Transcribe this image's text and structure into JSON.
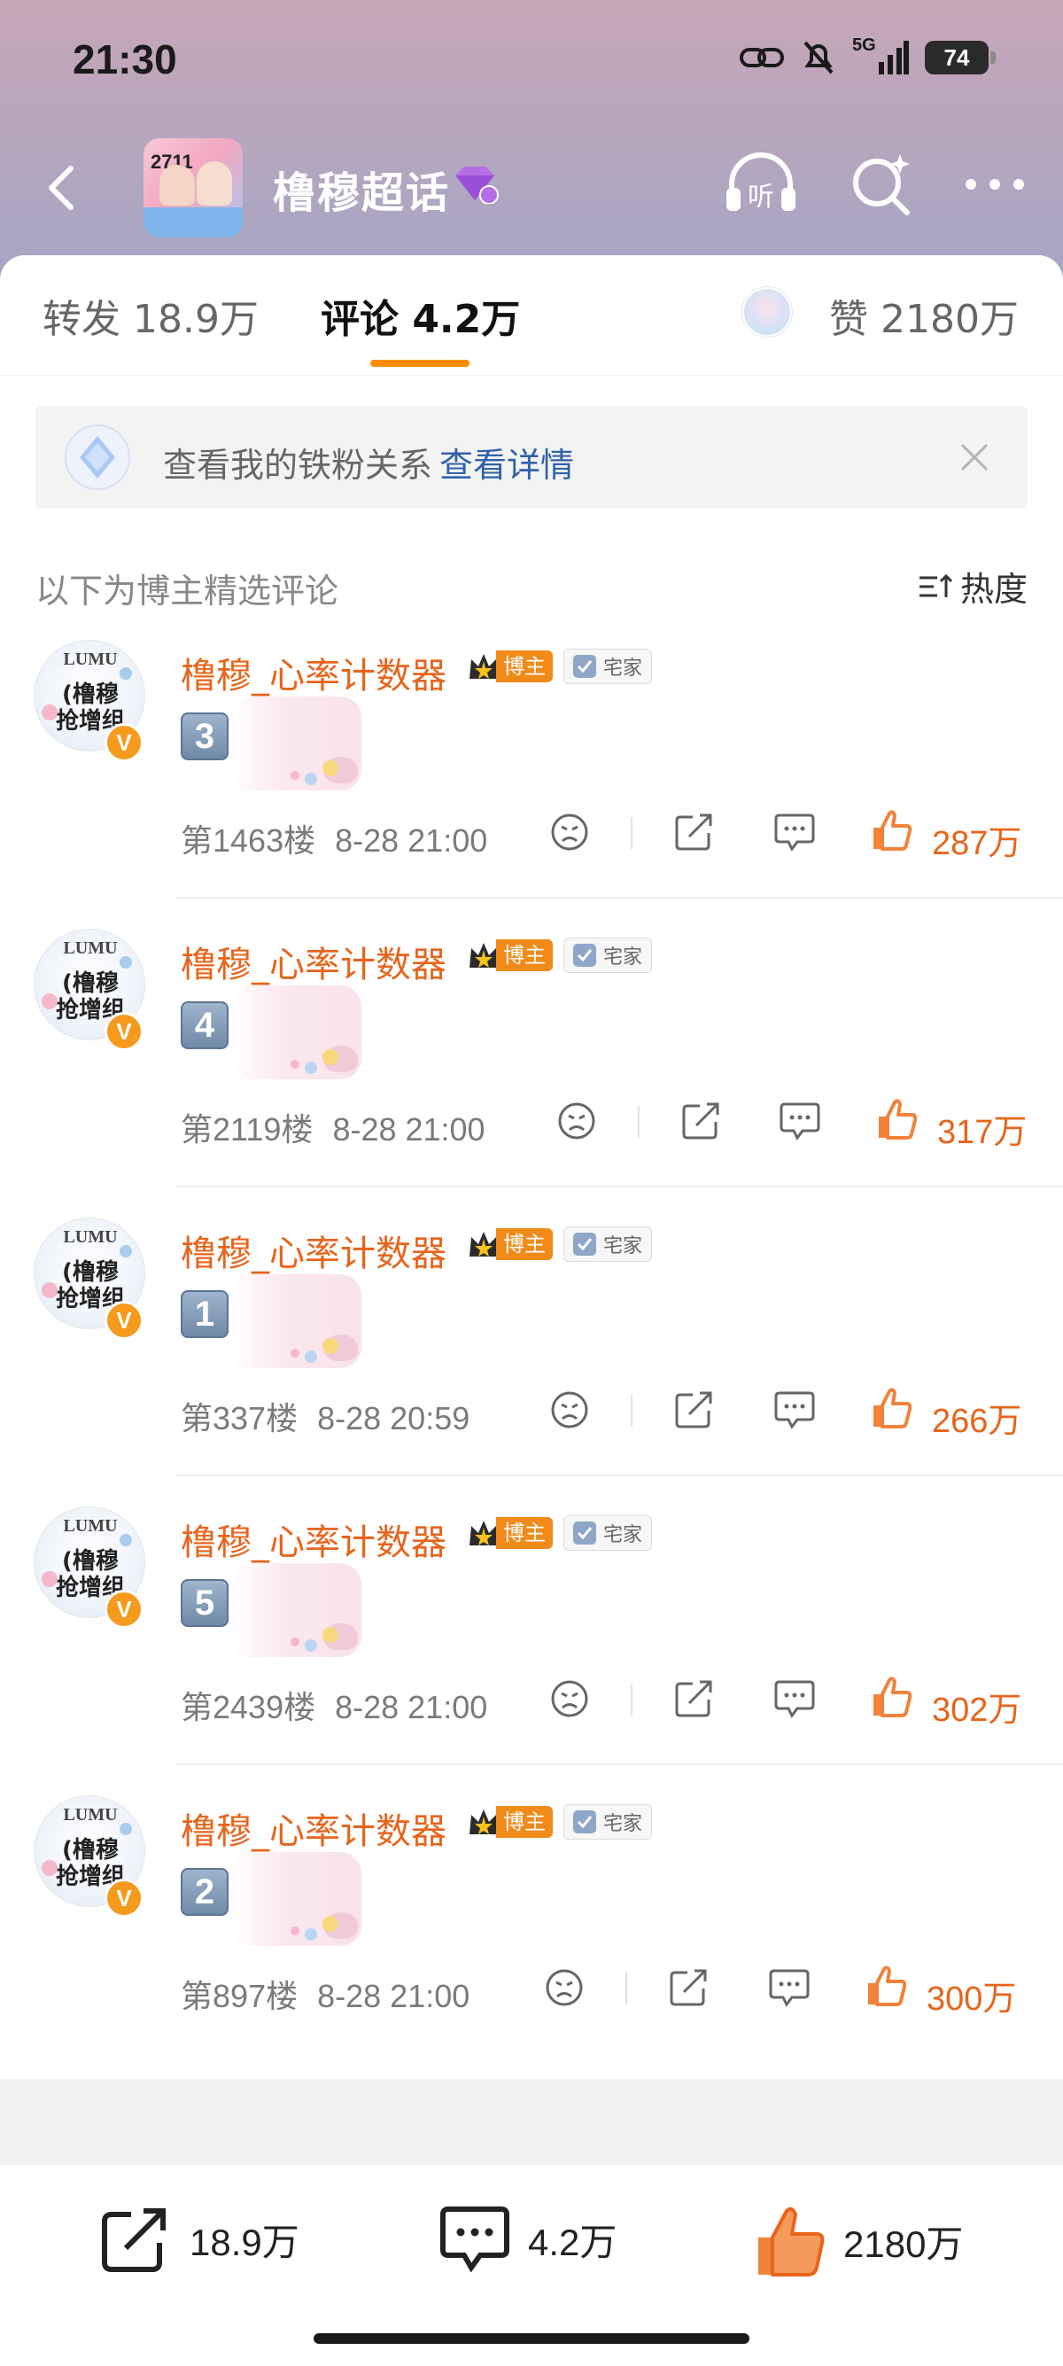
{
  "status_bar": {
    "time": "21:30",
    "network": "5G",
    "battery": "74"
  },
  "header": {
    "topic_title": "橹穆超话",
    "thumb_text": "2711"
  },
  "tabs": {
    "repost": "转发 18.9万",
    "comment": "评论 4.2万",
    "likes": "赞 2180万"
  },
  "fan_banner": {
    "text": "查看我的铁粉关系",
    "link": "查看详情"
  },
  "section": {
    "title": "以下为博主精选评论",
    "sort_label": "热度"
  },
  "author": {
    "avatar_top": "LUMU",
    "avatar_line1": "(橹穆",
    "avatar_line2": "抢增组",
    "verified": "V",
    "badge_bozhu": "博主",
    "badge_zhai": "宅家"
  },
  "comments": [
    {
      "name": "橹穆_心率计数器",
      "emoji": "3",
      "floor": "第1463楼",
      "time": "8-28 21:00",
      "likes": "287万"
    },
    {
      "name": "橹穆_心率计数器",
      "emoji": "4",
      "floor": "第2119楼",
      "time": "8-28 21:00",
      "likes": "317万"
    },
    {
      "name": "橹穆_心率计数器",
      "emoji": "1",
      "floor": "第337楼",
      "time": "8-28 20:59",
      "likes": "266万"
    },
    {
      "name": "橹穆_心率计数器",
      "emoji": "5",
      "floor": "第2439楼",
      "time": "8-28 21:00",
      "likes": "302万"
    },
    {
      "name": "橹穆_心率计数器",
      "emoji": "2",
      "floor": "第897楼",
      "time": "8-28 21:00",
      "likes": "300万"
    }
  ],
  "bottom_bar": {
    "repost_count": "18.9万",
    "comment_count": "4.2万",
    "like_count": "2180万"
  },
  "colors": {
    "accent_orange": "#e8641b",
    "tab_underline": "#ff8c00",
    "link_blue": "#2f62a8"
  }
}
